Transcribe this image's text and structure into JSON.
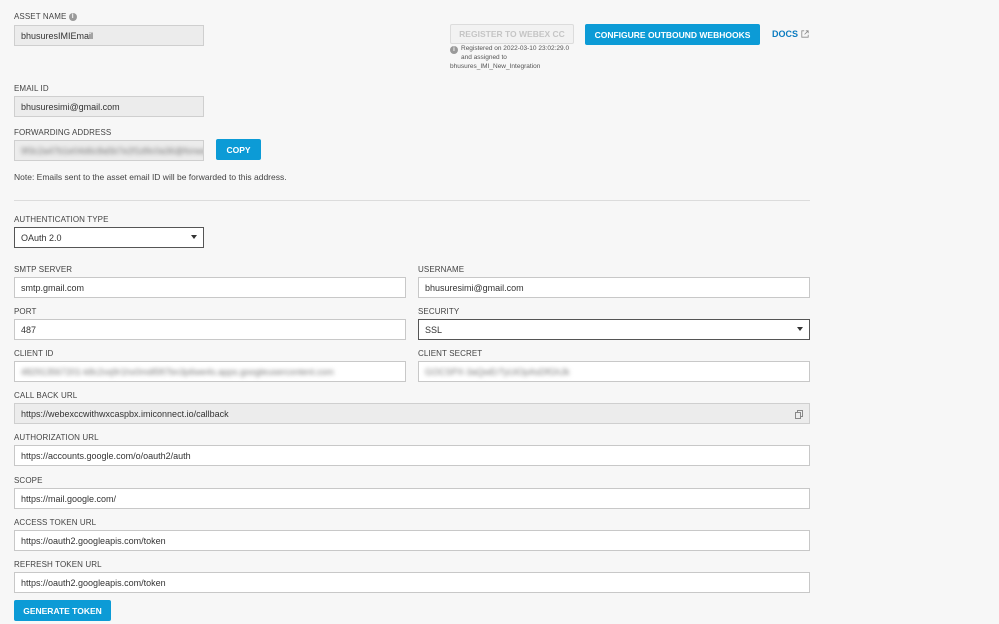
{
  "asset_name": {
    "label": "ASSET NAME",
    "value": "bhusuresIMIEmail"
  },
  "register": {
    "button_label": "REGISTER TO WEBEX CC",
    "status_line1": "Registered on 2022-03-10 23:02:29.0",
    "status_line2": "and assigned to",
    "status_line3": "bhusures_IMI_New_Integration"
  },
  "configure_button": "CONFIGURE OUTBOUND WEBHOOKS",
  "docs_link": "DOCS",
  "email_id": {
    "label": "EMAIL ID",
    "value": "bhusuresimi@gmail.com"
  },
  "forwarding": {
    "label": "FORWARDING ADDRESS",
    "value": "9f3c2a47b1e04d6c8a5b7e2f1d9c0a36@forward.imiconnect.io",
    "copy_label": "COPY",
    "note": "Note: Emails sent to the asset email ID will be forwarded to this address."
  },
  "auth_type": {
    "label": "AUTHENTICATION TYPE",
    "value": "OAuth 2.0"
  },
  "smtp_server": {
    "label": "SMTP SERVER",
    "value": "smtp.gmail.com"
  },
  "username": {
    "label": "USERNAME",
    "value": "bhusuresimi@gmail.com"
  },
  "port": {
    "label": "PORT",
    "value": "487"
  },
  "security": {
    "label": "SECURITY",
    "value": "SSL"
  },
  "client_id": {
    "label": "CLIENT ID",
    "value": "482913567201-k8c2vq9r1hx0mdl5ft7bn3p6we4s.apps.googleusercontent.com"
  },
  "client_secret": {
    "label": "CLIENT SECRET",
    "value": "GOCSPX-3aQwErTyUiOpAsDfGhJk"
  },
  "callback_url": {
    "label": "CALL BACK URL",
    "value": "https://webexccwithwxcaspbx.imiconnect.io/callback"
  },
  "authorization_url": {
    "label": "AUTHORIZATION URL",
    "value": "https://accounts.google.com/o/oauth2/auth"
  },
  "scope": {
    "label": "SCOPE",
    "value": "https://mail.google.com/"
  },
  "access_token_url": {
    "label": "ACCESS TOKEN URL",
    "value": "https://oauth2.googleapis.com/token"
  },
  "refresh_token_url": {
    "label": "REFRESH TOKEN URL",
    "value": "https://oauth2.googleapis.com/token"
  },
  "generate_button": "GENERATE TOKEN",
  "colors": {
    "accent": "#0c9bd6",
    "link": "#0c7cc0"
  },
  "icons": {
    "info": "info-icon",
    "external": "external-link-icon",
    "copy": "copy-icon",
    "caret": "chevron-down-icon"
  }
}
